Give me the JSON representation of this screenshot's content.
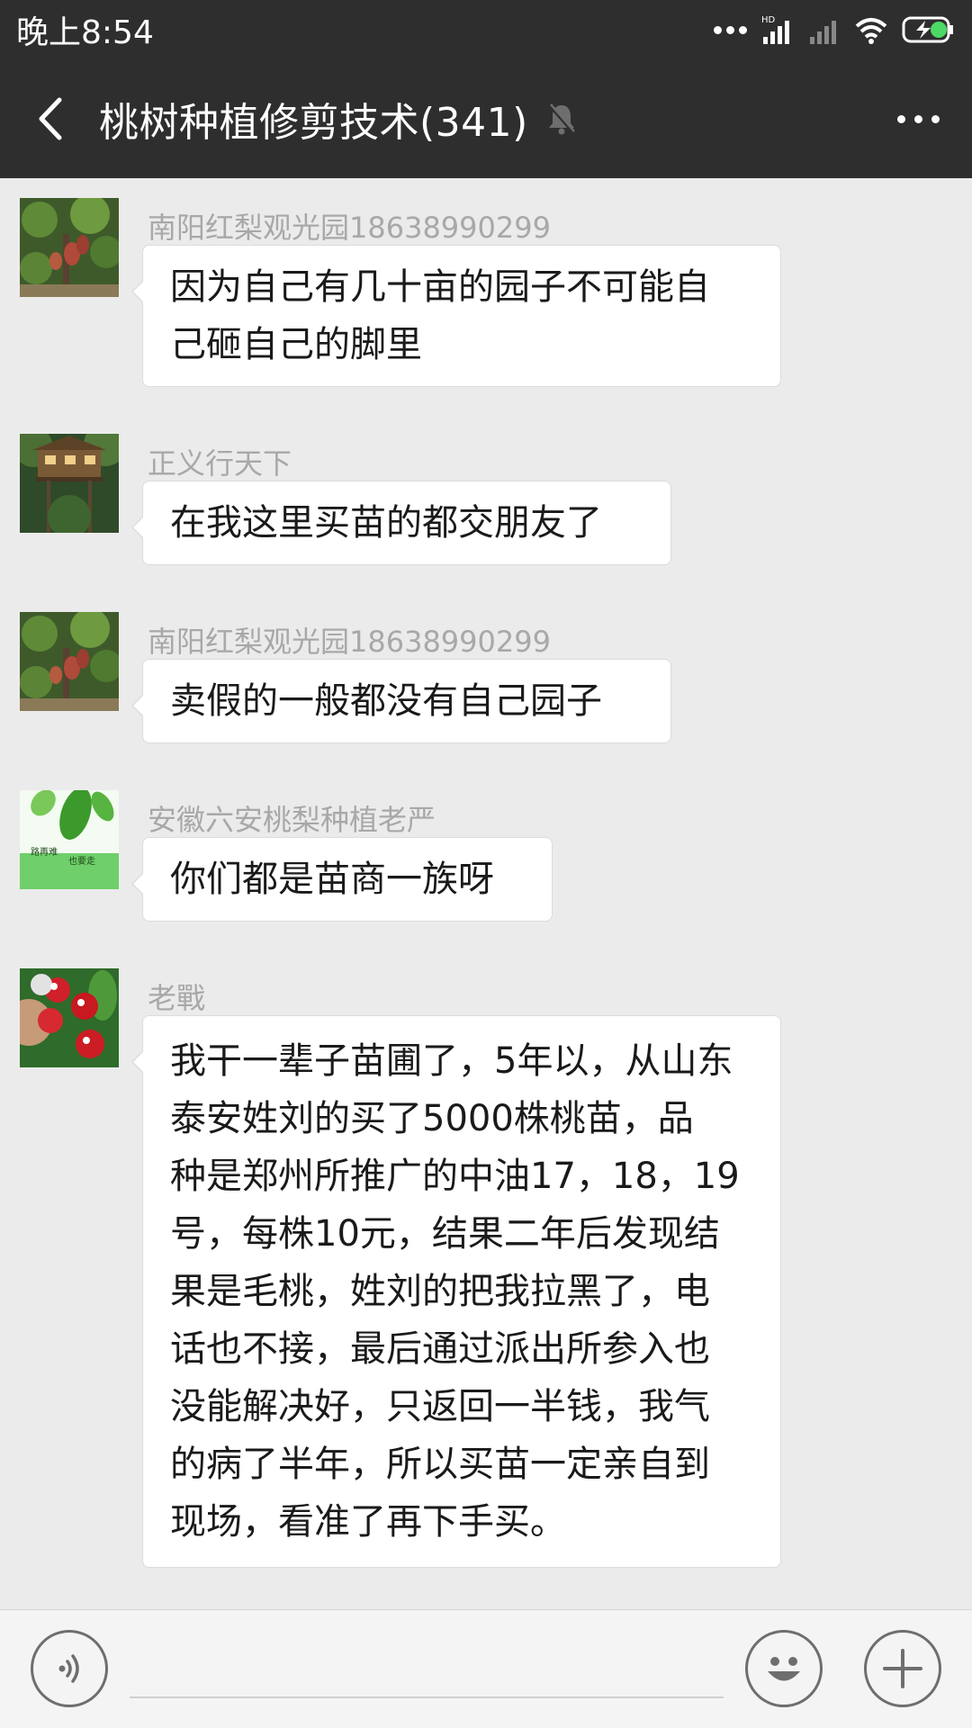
{
  "status_bar": {
    "time": "晚上8:54",
    "icons": [
      "more-dots-icon",
      "hd-signal-icon",
      "signal-icon",
      "wifi-icon",
      "battery-charging-icon"
    ],
    "hd_label": "HD"
  },
  "header": {
    "title": "桃树种植修剪技术(341)",
    "icons": [
      "back-arrow-icon",
      "mute-bell-icon",
      "more-options-icon"
    ]
  },
  "messages": [
    {
      "sender": "南阳红梨观光园18638990299",
      "lines": [
        "因为自己有几十亩的园子不可能自",
        "己砸自己的脚里"
      ],
      "avatar": "pear-tree-avatar"
    },
    {
      "sender": "正义行天下",
      "lines": [
        "在我这里买苗的都交朋友了"
      ],
      "avatar": "treehouse-avatar"
    },
    {
      "sender": "南阳红梨观光园18638990299",
      "lines": [
        "卖假的一般都没有自己园子"
      ],
      "avatar": "pear-tree-avatar"
    },
    {
      "sender": "安徽六安桃梨种植老严",
      "lines": [
        "你们都是苗商一族呀"
      ],
      "avatar": "green-leaf-avatar",
      "avatar_text_1": "路再难",
      "avatar_text_2": "也要走"
    },
    {
      "sender": "老戰",
      "lines": [
        "我干一辈子苗圃了，5年以，从山东",
        "泰安姓刘的买了5000株桃苗，品",
        "种是郑州所推广的中油17，18，19",
        "号，每株10元，结果二年后发现结",
        "果是毛桃，姓刘的把我拉黑了，电",
        "话也不接，最后通过派出所参入也",
        "没能解决好，只返回一半钱，我气",
        "的病了半年，所以买苗一定亲自到",
        "现场，看准了再下手买。"
      ],
      "avatar": "cherries-avatar"
    }
  ],
  "input_bar": {
    "icons": [
      "voice-icon",
      "emoji-icon",
      "plus-icon"
    ]
  },
  "colors": {
    "header_bg": "#2e2e2e",
    "chat_bg": "#ebebeb",
    "bubble_bg": "#ffffff",
    "sender_text": "#a8a8a8"
  }
}
